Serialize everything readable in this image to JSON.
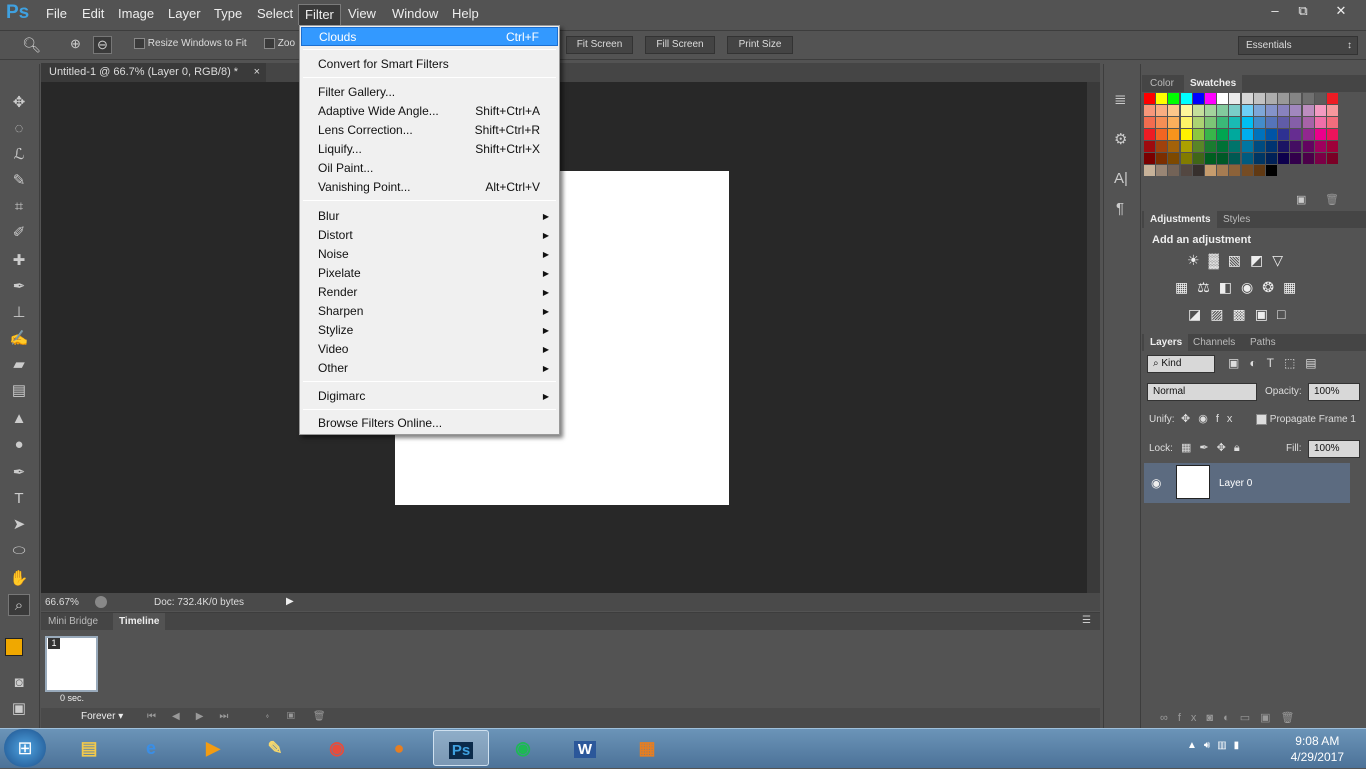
{
  "app": {
    "logo": "Ps"
  },
  "menu": [
    "File",
    "Edit",
    "Image",
    "Layer",
    "Type",
    "Select",
    "Filter",
    "View",
    "Window",
    "Help"
  ],
  "window_controls": {
    "minimize": "–",
    "restore": "⧉",
    "close": "✕"
  },
  "options": {
    "resize_windows": "Resize Windows to Fit",
    "zoom_all_truncated": "Zoo",
    "fit_screen": "Fit Screen",
    "fill_screen": "Fill Screen",
    "print_size": "Print Size",
    "workspace": "Essentials"
  },
  "document": {
    "tab_title": "Untitled-1 @ 66.7% (Layer 0, RGB/8) *",
    "zoom": "66.67%",
    "doc_info": "Doc: 732.4K/0 bytes"
  },
  "filter_menu": {
    "items": [
      {
        "label": "Clouds",
        "shortcut": "Ctrl+F"
      },
      {
        "label": "Convert for Smart Filters"
      },
      {
        "label": "Filter Gallery..."
      },
      {
        "label": "Adaptive Wide Angle...",
        "shortcut": "Shift+Ctrl+A"
      },
      {
        "label": "Lens Correction...",
        "shortcut": "Shift+Ctrl+R"
      },
      {
        "label": "Liquify...",
        "shortcut": "Shift+Ctrl+X"
      },
      {
        "label": "Oil Paint..."
      },
      {
        "label": "Vanishing Point...",
        "shortcut": "Alt+Ctrl+V"
      },
      {
        "label": "Blur"
      },
      {
        "label": "Distort"
      },
      {
        "label": "Noise"
      },
      {
        "label": "Pixelate"
      },
      {
        "label": "Render"
      },
      {
        "label": "Sharpen"
      },
      {
        "label": "Stylize"
      },
      {
        "label": "Video"
      },
      {
        "label": "Other"
      },
      {
        "label": "Digimarc"
      },
      {
        "label": "Browse Filters Online..."
      }
    ]
  },
  "timeline": {
    "tabs": [
      "Mini Bridge",
      "Timeline"
    ],
    "frame_number": "1",
    "frame_delay": "0 sec.",
    "loop": "Forever"
  },
  "panels": {
    "color_tabs": [
      "Color",
      "Swatches"
    ],
    "adjust_tabs": [
      "Adjustments",
      "Styles"
    ],
    "adjust_heading": "Add an adjustment",
    "layer_tabs": [
      "Layers",
      "Channels",
      "Paths"
    ],
    "kind": "Kind",
    "blend_mode": "Normal",
    "opacity_label": "Opacity:",
    "opacity": "100%",
    "unify_label": "Unify:",
    "propagate": "Propagate Frame 1",
    "lock_label": "Lock:",
    "fill_label": "Fill:",
    "fill": "100%",
    "layer_name": "Layer 0"
  },
  "swatch_colors": [
    [
      "#ff0000",
      "#ffff00",
      "#00ff00",
      "#00ffff",
      "#0000ff",
      "#ff00ff",
      "#ffffff",
      "#ebebeb",
      "#d6d6d6",
      "#c2c2c2",
      "#adadad",
      "#999999",
      "#858585",
      "#707070",
      "#5c5c5c",
      "#ed1c24"
    ],
    [
      "#f7977a",
      "#f9ad81",
      "#fdc68a",
      "#fff79a",
      "#c4df9b",
      "#a3d39c",
      "#82ca9d",
      "#7bcdc8",
      "#6ecff6",
      "#7ea7d8",
      "#8493ca",
      "#8882be",
      "#a187be",
      "#bc8dbf",
      "#f49ac2",
      "#f6989d"
    ],
    [
      "#f26c4f",
      "#f68e55",
      "#fbaf5c",
      "#fff467",
      "#acd372",
      "#7cc576",
      "#3bb878",
      "#1abbb4",
      "#00bff3",
      "#438cca",
      "#5574b9",
      "#605ca8",
      "#855fa8",
      "#a763a8",
      "#f06ea9",
      "#f26d7d"
    ],
    [
      "#ed1c24",
      "#f26522",
      "#f7941d",
      "#fff200",
      "#8dc73f",
      "#39b54a",
      "#00a651",
      "#00a99d",
      "#00aeef",
      "#0072bc",
      "#0054a6",
      "#2e3192",
      "#662d91",
      "#92278f",
      "#ec008c",
      "#ed145b"
    ],
    [
      "#9e0b0f",
      "#a0410d",
      "#a36209",
      "#aba000",
      "#598527",
      "#1a7b30",
      "#007236",
      "#00746b",
      "#0076a3",
      "#004b80",
      "#003471",
      "#1b1464",
      "#440e62",
      "#630460",
      "#9e005d",
      "#9e0039"
    ],
    [
      "#790000",
      "#7b2e00",
      "#7d4900",
      "#827b00",
      "#406618",
      "#005e20",
      "#005826",
      "#005952",
      "#005b7f",
      "#003663",
      "#002157",
      "#0d004c",
      "#32004b",
      "#4b0049",
      "#7b0046",
      "#7a0026"
    ],
    [
      "#c7b299",
      "#998675",
      "#736357",
      "#534741",
      "#37302d",
      "#c69c6d",
      "#a67c52",
      "#8c6239",
      "#754c24",
      "#603913",
      "#000000"
    ]
  ],
  "taskbar": {
    "items": [
      "start",
      "explorer",
      "ie",
      "media",
      "paint",
      "chrome",
      "firefox",
      "photoshop",
      "spotify",
      "word",
      "other"
    ],
    "time": "9:08 AM",
    "date": "4/29/2017"
  }
}
